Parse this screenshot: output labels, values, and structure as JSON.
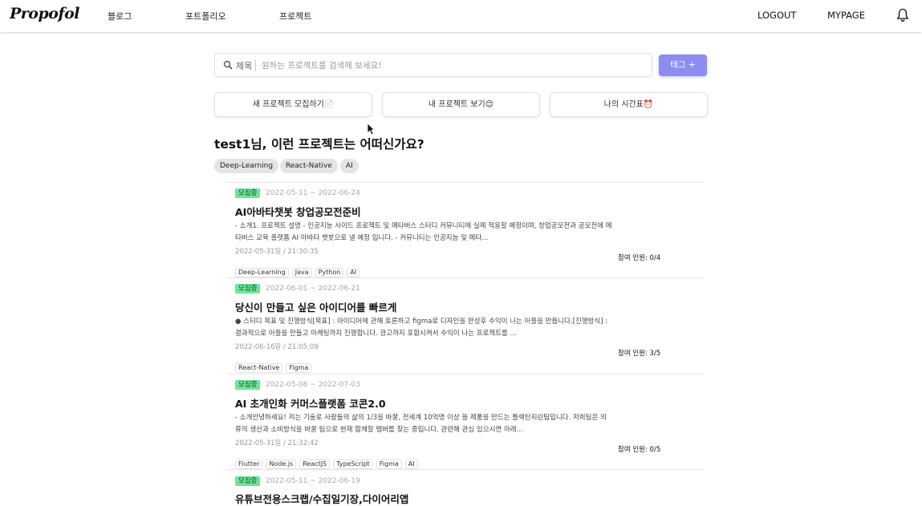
{
  "header": {
    "logo": "Propofol",
    "nav": [
      "블로그",
      "포트폴리오",
      "프로젝트"
    ],
    "logout": "LOGOUT",
    "mypage": "MYPAGE",
    "bell_icon": "bell-icon"
  },
  "search": {
    "category": "제목",
    "placeholder": "원하는 프로젝트를 검색해 보세요!",
    "tag_button": "태그 +",
    "accent": "#8c8cf2"
  },
  "actions": [
    "새 프로젝트 모집하기📄",
    "내 프로젝트 보기😊",
    "나의 시간표⏰"
  ],
  "recommend": {
    "heading": "test1님, 이런 프로젝트는 어떠신가요?",
    "tags": [
      "Deep-Learning",
      "React-Native",
      "AI"
    ]
  },
  "projects": [
    {
      "status": "모집중",
      "period": "2022-05-11 ~ 2022-06-24",
      "title": "AI아바타챗봇 창업공모전준비",
      "desc": "- 소개1. 프로젝트 설명 - 인공지능 사이드 프로젝트 및 메타버스 스터디 커뮤니티에 실제 적용할 예정이며, 창업공모전과 공모전에 메타버스 교육 플랫폼 AI 아바타 챗봇으로 낼 예정 입니다. - 커뮤니티는 인공지능 및 메타...",
      "created": "2022-05-31일 / 21:30:35",
      "tags": [
        "Deep-Learning",
        "Java",
        "Python",
        "AI"
      ],
      "people": "참여 인원: 0/4"
    },
    {
      "status": "모집중",
      "period": "2022-06-01 ~ 2022-06-21",
      "title": "당신이 만들고 싶은 아이디어를 빠르게",
      "desc": "● 스터디 목표 및 진행방식[목표] : 아이디어에 관해 토론하고 figma로 디자인을 완성후 수익이 나는 어플을 만듭니다.[진행방식] : 결과적으로 어플을 만들고 마케팅까지 진행합니다. 광고까지 포함시켜서 수익이 나는 프로젝트를 ...",
      "created": "2022-06-16일 / 21:05:09",
      "tags": [
        "React-Native",
        "Figma"
      ],
      "people": "참여 인원: 3/5"
    },
    {
      "status": "모집중",
      "period": "2022-05-08 ~ 2022-07-03",
      "title": "AI 초개인화 커머스플랫폼 코콘2.0",
      "desc": "- 소개안녕하세요! 저는 기술로 사람들의 삶의 1/3을 바꿀, 전세계 10억명 이상 쓸 제품을 만드는 틀렉탄지린팀입니다. 저희팀은 의류의 생산과 소비방식을 바꿀 팀으로 현재 함께할 멤버를 찾는 중입니다. 관련해 관심 있으시면 아래...",
      "created": "2022-05-31일 / 21:32:42",
      "tags": [
        "Flutter",
        "Node.js",
        "ReactJS",
        "TypeScript",
        "Figma",
        "AI"
      ],
      "people": "참여 인원: 0/5"
    },
    {
      "status": "모집중",
      "period": "2022-05-11 ~ 2022-06-19",
      "title": "유튜브전용스크랩/수집일기장,다이어리앱"
    }
  ]
}
